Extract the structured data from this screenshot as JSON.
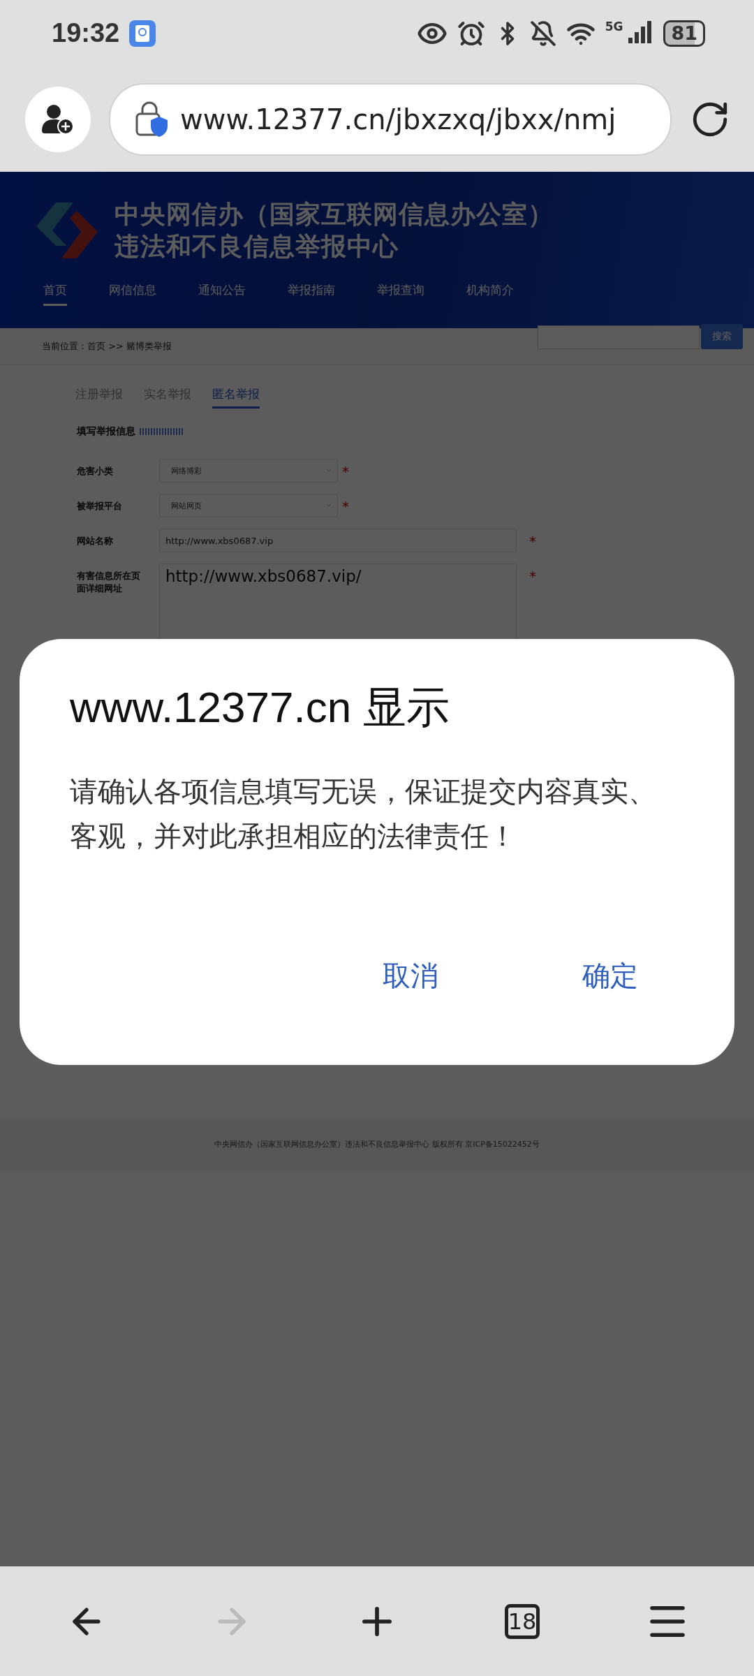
{
  "status_bar": {
    "time": "19:32",
    "network": "5G",
    "battery": "81"
  },
  "browser": {
    "url": "www.12377.cn/jbxzxq/jbxx/nmj"
  },
  "site": {
    "title_lines": [
      "中央网信办（国家互联网信息办公室）",
      "违法和不良信息举报中心"
    ],
    "nav": [
      {
        "label": "首页",
        "selected": true
      },
      {
        "label": "网信信息",
        "selected": false
      },
      {
        "label": "通知公告",
        "selected": false
      },
      {
        "label": "举报指南",
        "selected": false
      },
      {
        "label": "举报查询",
        "selected": false
      },
      {
        "label": "机构简介",
        "selected": false
      }
    ],
    "search_button": "搜索",
    "breadcrumb": "当前位置：首页 >> 赌博类举报"
  },
  "form": {
    "tabs": [
      {
        "label": "注册举报",
        "selected": false
      },
      {
        "label": "实名举报",
        "selected": false
      },
      {
        "label": "匿名举报",
        "selected": true
      }
    ],
    "section_title": "填写举报信息",
    "fields": [
      {
        "kind": "select",
        "label": "危害小类",
        "value": "网络博彩",
        "mark": "*"
      },
      {
        "kind": "select",
        "label": "被举报平台",
        "value": "网站网页",
        "mark": "*"
      },
      {
        "kind": "input",
        "label": "网站名称",
        "value": "http://www.xbs0687.vip",
        "mark": "*"
      },
      {
        "kind": "textarea",
        "label": "有害信息所在页面详细网址",
        "value": "http://www.xbs0687.vip/",
        "mark": "*"
      }
    ]
  },
  "footer": "中央网信办（国家互联网信息办公室）违法和不良信息举报中心 版权所有 京ICP备15022452号",
  "dialog": {
    "title": "www.12377.cn 显示",
    "message": "请确认各项信息填写无误，保证提交内容真实、客观，并对此承担相应的法律责任！",
    "buttons": [
      "取消",
      "确定"
    ]
  },
  "bottom_nav": [
    {
      "kind": "back",
      "disabled": false
    },
    {
      "kind": "forward",
      "disabled": true
    },
    {
      "kind": "new-tab",
      "disabled": false
    },
    {
      "kind": "tabs",
      "label": "18",
      "disabled": false
    },
    {
      "kind": "menu",
      "disabled": false
    }
  ]
}
